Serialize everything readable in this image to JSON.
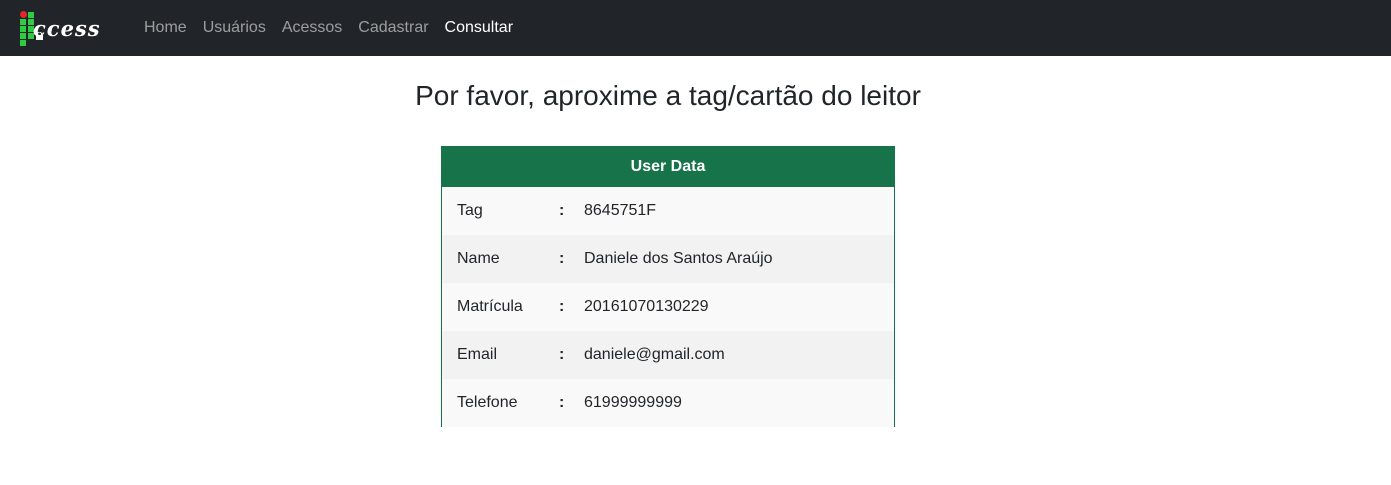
{
  "navbar": {
    "brand_text": "ccess",
    "links": [
      {
        "label": "Home",
        "active": false
      },
      {
        "label": "Usuários",
        "active": false
      },
      {
        "label": "Acessos",
        "active": false
      },
      {
        "label": "Cadastrar",
        "active": false
      },
      {
        "label": "Consultar",
        "active": true
      }
    ]
  },
  "main": {
    "title": "Por favor, aproxime a tag/cartão do leitor",
    "card": {
      "header": "User Data",
      "separator": ":",
      "rows": [
        {
          "label": "Tag",
          "value": "8645751F"
        },
        {
          "label": "Name",
          "value": "Daniele dos Santos Araújo"
        },
        {
          "label": "Matrícula",
          "value": "20161070130229"
        },
        {
          "label": "Email",
          "value": "daniele@gmail.com"
        },
        {
          "label": "Telefone",
          "value": "61999999999"
        }
      ]
    }
  },
  "colors": {
    "navbar_bg": "#212529",
    "card_accent": "#17744a",
    "logo_green": "#2ecc40",
    "logo_red": "#e3262a"
  }
}
